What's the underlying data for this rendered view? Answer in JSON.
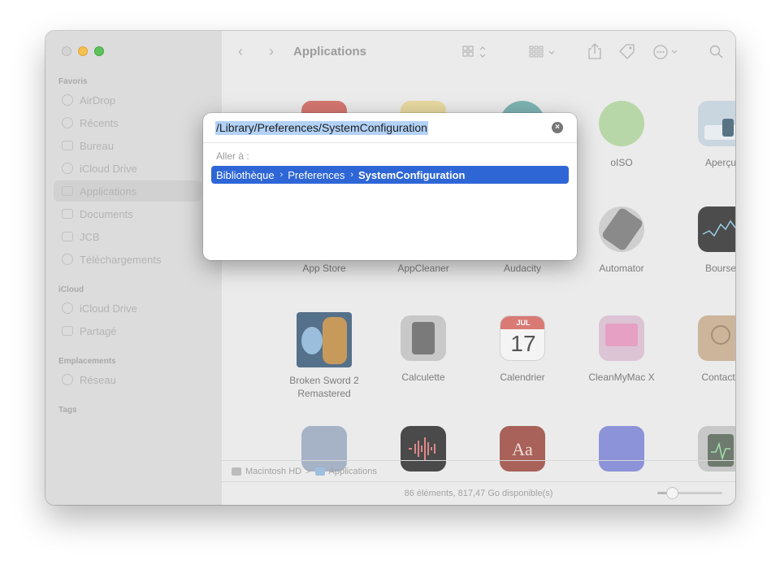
{
  "window": {
    "title": "Applications",
    "path": {
      "disk": "Macintosh HD",
      "separator": ">",
      "folder": "Applications"
    },
    "status": "86 éléments, 817,47 Go disponible(s)"
  },
  "sidebar": {
    "favorites_header": "Favoris",
    "favorites": [
      {
        "label": "AirDrop",
        "icon": "airdrop-icon"
      },
      {
        "label": "Récents",
        "icon": "clock-icon"
      },
      {
        "label": "Bureau",
        "icon": "folder-icon"
      },
      {
        "label": "iCloud Drive",
        "icon": "cloud-icon"
      },
      {
        "label": "Applications",
        "icon": "applications-icon"
      },
      {
        "label": "Documents",
        "icon": "folder-icon"
      },
      {
        "label": "JCB",
        "icon": "folder-icon"
      },
      {
        "label": "Téléchargements",
        "icon": "download-icon"
      }
    ],
    "icloud_header": "iCloud",
    "icloud": [
      {
        "label": "iCloud Drive",
        "icon": "cloud-icon"
      },
      {
        "label": "Partagé",
        "icon": "shared-folder-icon"
      }
    ],
    "locations_header": "Emplacements",
    "locations": [
      {
        "label": "Réseau",
        "icon": "network-icon"
      }
    ],
    "tags_header": "Tags"
  },
  "apps": {
    "row1": [
      "",
      "",
      "",
      "oISO",
      "Aperçu"
    ],
    "row2": [
      "App Store",
      "AppCleaner",
      "Audacity",
      "Automator",
      "Bourse"
    ],
    "row3": [
      "Broken Sword 2 Remastered",
      "Calculette",
      "Calendrier",
      "CleanMyMac X",
      "Contacts"
    ],
    "calendar_month": "JUL",
    "calendar_day": "17",
    "dictionary_glyph": "Aa"
  },
  "goto_dialog": {
    "input_value": "/Library/Preferences/SystemConfiguration",
    "goto_label": "Aller à :",
    "suggestion": {
      "segments": [
        "Bibliothèque",
        "Preferences",
        "SystemConfiguration"
      ],
      "separator": "›"
    }
  },
  "colors": {
    "selection": "#2e66d6",
    "text_highlight": "#b3d2f7",
    "traffic_yellow": "#f6c04e",
    "traffic_green": "#5cc25a"
  }
}
